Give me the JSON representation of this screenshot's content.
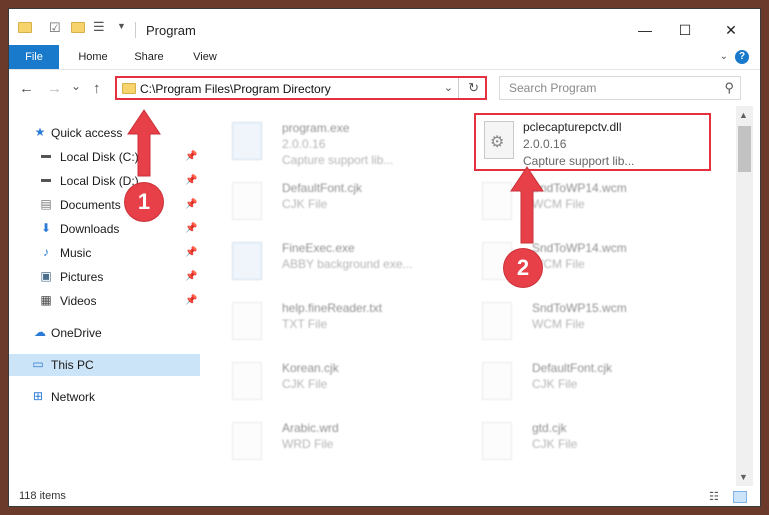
{
  "window": {
    "title": "Program",
    "minimize": "—",
    "maximize": "☐",
    "close": "✕"
  },
  "ribbon": {
    "tabs": [
      "File",
      "Home",
      "Share",
      "View"
    ],
    "help": "?"
  },
  "nav": {
    "back": "←",
    "forward": "→",
    "dropdown": "⌄",
    "up": "↑",
    "address": "C:\\Program Files\\Program Directory",
    "search_placeholder": "Search Program"
  },
  "sidebar": {
    "items": [
      {
        "label": "Quick access",
        "icon": "star-icon"
      },
      {
        "label": "Local Disk (C:)",
        "icon": "drive-icon",
        "pinned": true
      },
      {
        "label": "Local Disk (D:)",
        "icon": "drive-icon",
        "pinned": true
      },
      {
        "label": "Documents",
        "icon": "documents-icon",
        "pinned": true
      },
      {
        "label": "Downloads",
        "icon": "download-icon",
        "pinned": true
      },
      {
        "label": "Music",
        "icon": "music-icon",
        "pinned": true
      },
      {
        "label": "Pictures",
        "icon": "pictures-icon",
        "pinned": true
      },
      {
        "label": "Videos",
        "icon": "videos-icon",
        "pinned": true
      },
      {
        "label": "OneDrive",
        "icon": "cloud-icon"
      },
      {
        "label": "This PC",
        "icon": "computer-icon",
        "selected": true
      },
      {
        "label": "Network",
        "icon": "network-icon"
      }
    ]
  },
  "files_left": [
    {
      "name": "program.exe",
      "line2": "2.0.0.16",
      "line3": "Capture support lib...",
      "type": "exe"
    },
    {
      "name": "DefaultFont.cjk",
      "line2": "CJK File",
      "type": "doc"
    },
    {
      "name": "FineExec.exe",
      "line2": "ABBY background exe...",
      "type": "exe"
    },
    {
      "name": "help.fineReader.txt",
      "line2": "TXT File",
      "type": "doc"
    },
    {
      "name": "Korean.cjk",
      "line2": "CJK File",
      "type": "doc"
    },
    {
      "name": "Arabic.wrd",
      "line2": "WRD File",
      "type": "doc"
    }
  ],
  "files_right": [
    {
      "name": "SndToWP14.wcm",
      "line2": "WCM File",
      "type": "doc"
    },
    {
      "name": "SndToWP14.wcm",
      "line2": "WCM File",
      "type": "doc"
    },
    {
      "name": "SndToWP15.wcm",
      "line2": "WCM File",
      "type": "doc"
    },
    {
      "name": "DefaultFont.cjk",
      "line2": "CJK File",
      "type": "doc"
    },
    {
      "name": "gtd.cjk",
      "line2": "CJK File",
      "type": "doc"
    }
  ],
  "highlighted_file": {
    "name": "pclecapturepctv.dll",
    "version": "2.0.0.16",
    "description": "Capture support lib..."
  },
  "status": {
    "items": "118 items"
  },
  "annotations": {
    "badge1": "1",
    "badge2": "2"
  },
  "colors": {
    "accent": "#1979ca",
    "highlight": "#e53040",
    "selected": "#cce4f7"
  }
}
